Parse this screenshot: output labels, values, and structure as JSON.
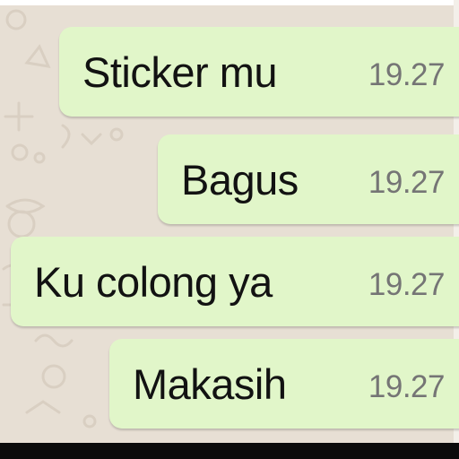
{
  "chat": {
    "messages": [
      {
        "text": "Sticker mu",
        "time": "19.27"
      },
      {
        "text": "Bagus",
        "time": "19.27"
      },
      {
        "text": "Ku colong ya",
        "time": "19.27"
      },
      {
        "text": "Makasih",
        "time": "19.27"
      }
    ]
  },
  "colors": {
    "background": "#e7dfd4",
    "outgoing_bubble": "#e1f6c9",
    "message_text": "#121212",
    "timestamp_text": "#757575"
  },
  "icons": [
    "chat-wallpaper-doodle-icons"
  ]
}
